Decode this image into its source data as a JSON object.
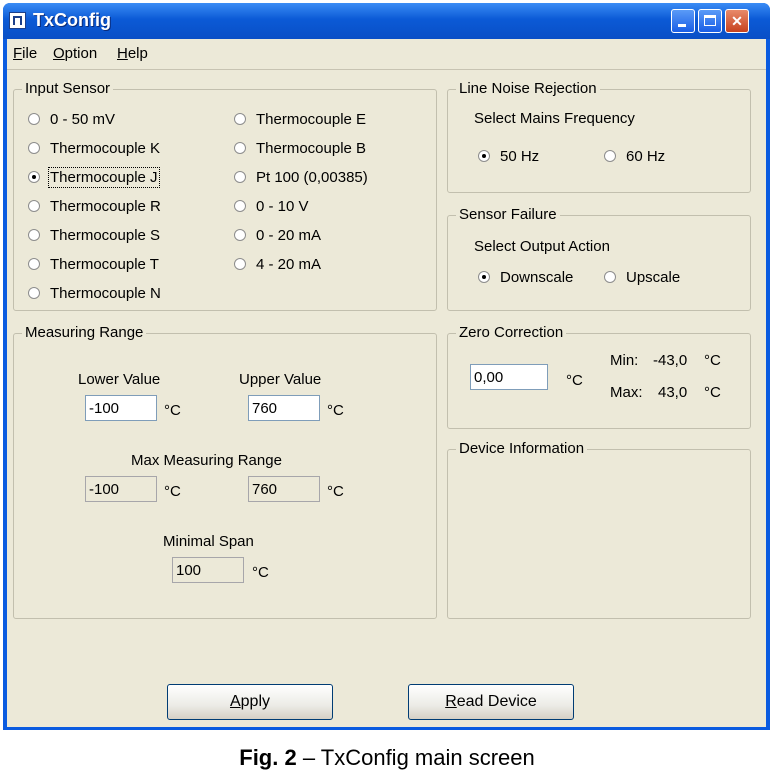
{
  "window": {
    "title": "TxConfig"
  },
  "menu": [
    {
      "first": "F",
      "rest": "ile"
    },
    {
      "first": "O",
      "rest": "ption"
    },
    {
      "first": "H",
      "rest": "elp"
    }
  ],
  "input_sensor": {
    "title": "Input Sensor",
    "options_col1": [
      "0 - 50 mV",
      "Thermocouple K",
      "Thermocouple J",
      "Thermocouple R",
      "Thermocouple S",
      "Thermocouple T",
      "Thermocouple N"
    ],
    "options_col2": [
      "Thermocouple E",
      "Thermocouple B",
      "Pt 100 (0,00385)",
      "0 - 10 V",
      "0 - 20 mA",
      "4 - 20 mA"
    ],
    "selected": "Thermocouple J"
  },
  "line_noise": {
    "title": "Line Noise Rejection",
    "prompt": "Select Mains Frequency",
    "option_50": "50 Hz",
    "option_60": "60 Hz",
    "selected": "50 Hz"
  },
  "sensor_failure": {
    "title": "Sensor Failure",
    "prompt": "Select Output Action",
    "option_down": "Downscale",
    "option_up": "Upscale",
    "selected": "Downscale"
  },
  "measuring_range": {
    "title": "Measuring Range",
    "lower_label": "Lower Value",
    "upper_label": "Upper Value",
    "lower_value": "-100",
    "upper_value": "760",
    "unit": "°C",
    "max_range_label": "Max Measuring Range",
    "max_lower": "-100",
    "max_upper": "760",
    "min_span_label": "Minimal Span",
    "min_span": "100"
  },
  "zero_correction": {
    "title": "Zero Correction",
    "value": "0,00",
    "unit": "°C",
    "min_label": "Min:",
    "min_value": "-43,0",
    "max_label": "Max:",
    "max_value": "43,0"
  },
  "device_info": {
    "title": "Device Information"
  },
  "buttons": {
    "apply_first": "A",
    "apply_rest": "pply",
    "read_first": "R",
    "read_rest": "ead Device"
  },
  "caption": {
    "prefix": "Fig. 2",
    "text": " – TxConfig main screen"
  }
}
